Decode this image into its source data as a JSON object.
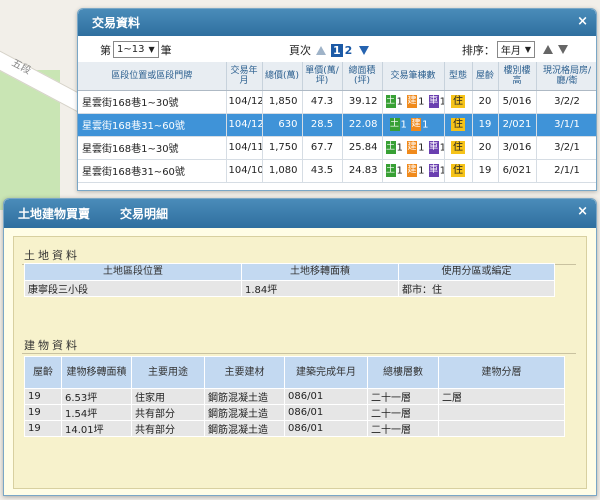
{
  "map": {
    "road_label": "五段"
  },
  "list_window": {
    "title": "交易資料",
    "close": "×",
    "range_prefix": "第",
    "range_value": "1~13",
    "range_suffix": "筆",
    "page_label": "頁次",
    "pages": [
      "1",
      "2"
    ],
    "sort_label": "排序：",
    "sort_value": "年月",
    "columns": [
      "區段位置或區段門牌",
      "交易年月",
      "總價(萬)",
      "單價(萬/坪)",
      "總面積(坪)",
      "交易筆棟數",
      "型態",
      "屋齡",
      "樓別樓高",
      "現況格局房/廳/衛"
    ],
    "rows": [
      {
        "address": "星雲街168巷1~30號",
        "date": "104/12",
        "total": "1,850",
        "unit": "47.3",
        "area": "39.12",
        "land": "1",
        "bld": "1",
        "car": "1",
        "type": "住",
        "age": "20",
        "floor": "5/016",
        "layout": "3/2/2"
      },
      {
        "address": "星雲街168巷31~60號",
        "date": "104/12",
        "total": "630",
        "unit": "28.5",
        "area": "22.08",
        "land": "1",
        "bld": "1",
        "car": "",
        "type": "住",
        "age": "19",
        "floor": "2/021",
        "layout": "3/1/1"
      },
      {
        "address": "星雲街168巷1~30號",
        "date": "104/11",
        "total": "1,750",
        "unit": "67.7",
        "area": "25.84",
        "land": "1",
        "bld": "1",
        "car": "1",
        "type": "住",
        "age": "20",
        "floor": "3/016",
        "layout": "3/2/1"
      },
      {
        "address": "星雲街168巷31~60號",
        "date": "104/10",
        "total": "1,080",
        "unit": "43.5",
        "area": "24.83",
        "land": "1",
        "bld": "1",
        "car": "1",
        "type": "住",
        "age": "19",
        "floor": "6/021",
        "layout": "2/1/1"
      }
    ],
    "badge_land": "土",
    "badge_bld": "建",
    "badge_car": "車"
  },
  "detail_window": {
    "title": "土地建物買賣",
    "subtitle": "交易明細",
    "close": "×",
    "land_section": "土地資料",
    "land_columns": [
      "土地區段位置",
      "土地移轉面積",
      "使用分區或編定"
    ],
    "land_rows": [
      {
        "location": "康寧段三小段",
        "area": "1.84坪",
        "zoning": "都市：住"
      }
    ],
    "building_section": "建物資料",
    "building_columns": [
      "屋齡",
      "建物移轉面積",
      "主要用途",
      "主要建材",
      "建築完成年月",
      "總樓層數",
      "建物分層"
    ],
    "building_rows": [
      {
        "age": "19",
        "area": "6.53坪",
        "use": "住家用",
        "material": "鋼筋混凝土造",
        "completed": "086/01",
        "floors": "二十一層",
        "level": "二層"
      },
      {
        "age": "19",
        "area": "1.54坪",
        "use": "共有部分",
        "material": "鋼筋混凝土造",
        "completed": "086/01",
        "floors": "二十一層",
        "level": ""
      },
      {
        "age": "19",
        "area": "14.01坪",
        "use": "共有部分",
        "material": "鋼筋混凝土造",
        "completed": "086/01",
        "floors": "二十一層",
        "level": ""
      }
    ]
  },
  "colors": {
    "titlebar": "#2f6f9f",
    "selected_row": "#3f93d8",
    "land_badge": "#38a035",
    "building_badge": "#f08a1c",
    "parking_badge": "#6a3fb0",
    "type_badge": "#f6c319",
    "detail_bg": "#f7f2cc",
    "detail_header": "#c3d9f1"
  }
}
